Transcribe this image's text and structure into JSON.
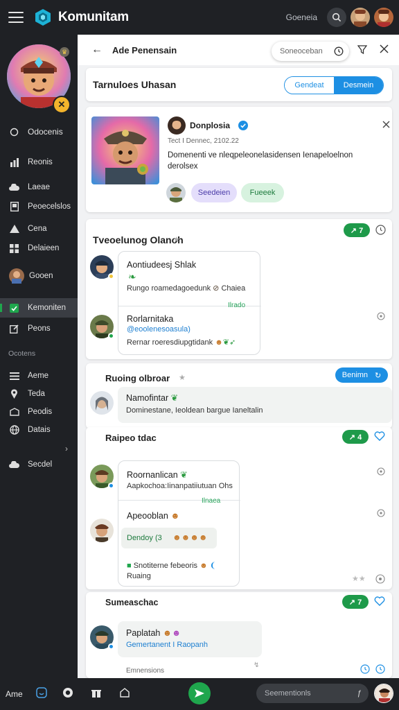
{
  "app": {
    "brand": "Komunitam",
    "top_label": "Goeneia"
  },
  "sidebar": {
    "status_label": "Odocenis",
    "items": [
      {
        "label": "Reonis",
        "icon": "chart-icon"
      },
      {
        "label": "Laeae",
        "icon": "cloud-icon"
      },
      {
        "label": "Peoecelslos",
        "icon": "document-icon"
      },
      {
        "label": "Cena",
        "icon": "triangle-icon"
      },
      {
        "label": "Delaieen",
        "icon": "grid-icon"
      },
      {
        "label": "Gooen",
        "icon": "user-avatar-icon"
      },
      {
        "label": "Kemoniten",
        "icon": "check-icon"
      },
      {
        "label": "Peons",
        "icon": "edit-icon"
      }
    ],
    "section_label": "Ocotens",
    "items2": [
      {
        "label": "Aeme",
        "icon": "list-icon"
      },
      {
        "label": "Teda",
        "icon": "pin-icon"
      },
      {
        "label": "Peodis",
        "icon": "note-icon"
      },
      {
        "label": "Datais",
        "icon": "globe-icon"
      }
    ],
    "last_item": {
      "label": "Secdel",
      "icon": "cloud-icon"
    }
  },
  "panel": {
    "title": "Ade Penensain",
    "search_placeholder": "Soneoceban"
  },
  "header_card": {
    "title": "Tarnuloes Uhasan",
    "seg_left": "Gendeat",
    "seg_right": "Desmein"
  },
  "post": {
    "author": "Donplosia",
    "meta": "Tect  I  Dennec, 2102.22",
    "text": "Domenenti ve nleqpeleonelasidensen  Ienapeloelnon derolsex",
    "btn_left": "Seedeien",
    "btn_right": "Fueeek"
  },
  "thread1": {
    "title": "Tveoelunog Olanoh",
    "chip": "↗ 7",
    "msg1_title": "Aontiudeesj Shlak",
    "msg1_text": "Rungo roamedagoedunk",
    "msg1_tag": "Chaiea",
    "msg1_time": "Ilrado",
    "msg2_title": "Rorlarnitaka",
    "msg2_link": "@eoolenesoasula)",
    "msg2_text": "Rernar roeresdiupgtidank"
  },
  "thread2": {
    "title": "Ruoing olbroar",
    "chip": "Benimn",
    "msg_title": "Namofintar",
    "msg_text": "Dominestane, Ieoldean bargue Ianeltalin"
  },
  "thread3": {
    "title": "Raipeo tdac",
    "chip": "↗ 4",
    "msg1_title": "Roornanlican",
    "msg1_text": "Aapkochoa:Iinanpatiiutuan Ohs",
    "msg1_time": "Ilnaea",
    "msg2_title": "Apeooblan",
    "msg2_chip": "Dendoy  (3",
    "msg3_title": "Snotiterne febeoris",
    "msg3_sub": "Ruaing"
  },
  "thread4": {
    "title": "Sumeaschac",
    "chip": "↗ 7",
    "msg_title": "Paplatah",
    "msg_link": "Gemertanent  I  Raopanh",
    "footer": "Emnensions"
  },
  "bottom": {
    "label": "Ame",
    "input_placeholder": "Seementionls",
    "attach": "ƒ"
  },
  "colors": {
    "accent_green": "#1fa64d",
    "accent_blue": "#1d8fe3",
    "dark": "#1f2125"
  }
}
